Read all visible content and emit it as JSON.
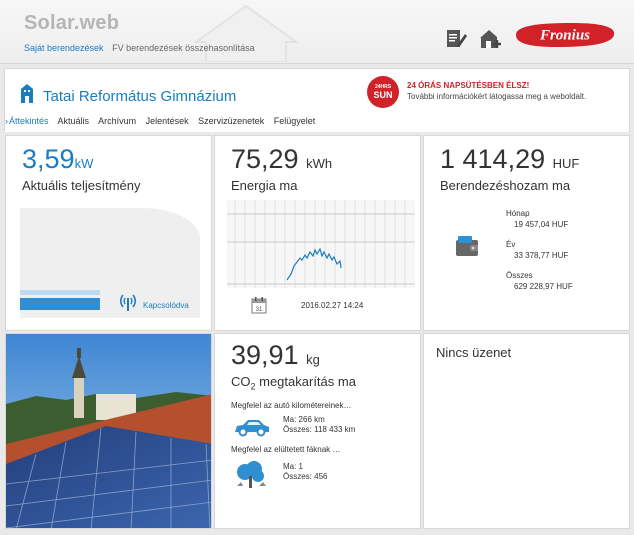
{
  "header": {
    "brand": "Solar.web",
    "nav": [
      "Saját berendezések",
      "FV berendezések összehasonlítása"
    ],
    "logo_text": "Fronius"
  },
  "site": {
    "name": "Tatai Református Gimnázium",
    "promo_badge_line1": "24HRS",
    "promo_badge_line2": "SUN",
    "promo_title": "24 ÓRÁS NAPSÜTÉSBEN ÉLSZ!",
    "promo_text": "További információkért látogassa meg a weboldalt."
  },
  "subnav": {
    "items": [
      "Áttekintés",
      "Aktuális",
      "Archívum",
      "Jelentések",
      "Szervizüzenetek",
      "Felügyelet"
    ]
  },
  "power": {
    "value": "3,59",
    "unit": "kW",
    "label": "Aktuális teljesítmény",
    "status": "Kapcsolódva"
  },
  "energy": {
    "value": "75,29",
    "unit": "kWh",
    "label": "Energia ma",
    "date": "2016.02.27 14:24"
  },
  "yield": {
    "value": "1 414,29",
    "unit": "HUF",
    "label": "Berendezéshozam ma",
    "month_label": "Hónap",
    "month_value": "19 457,04 HUF",
    "year_label": "Év",
    "year_value": "33 378,77 HUF",
    "total_label": "Összes",
    "total_value": "629 228,97 HUF"
  },
  "co2": {
    "value": "39,91",
    "unit": "kg",
    "label_pre": "CO",
    "label_sub": "2",
    "label_post": " megtakarítás ma",
    "car_text": "Megfelel az autó kilométereinek…",
    "car_today": "Ma: 266 km",
    "car_total": "Összes: 118 433 km",
    "tree_text": "Megfelel az elültetett fáknak …",
    "tree_today": "Ma: 1",
    "tree_total": "Összes: 456"
  },
  "messages": {
    "label": "Nincs üzenet"
  },
  "colors": {
    "accent": "#1a7dc0",
    "fronius_red": "#d1222a"
  }
}
